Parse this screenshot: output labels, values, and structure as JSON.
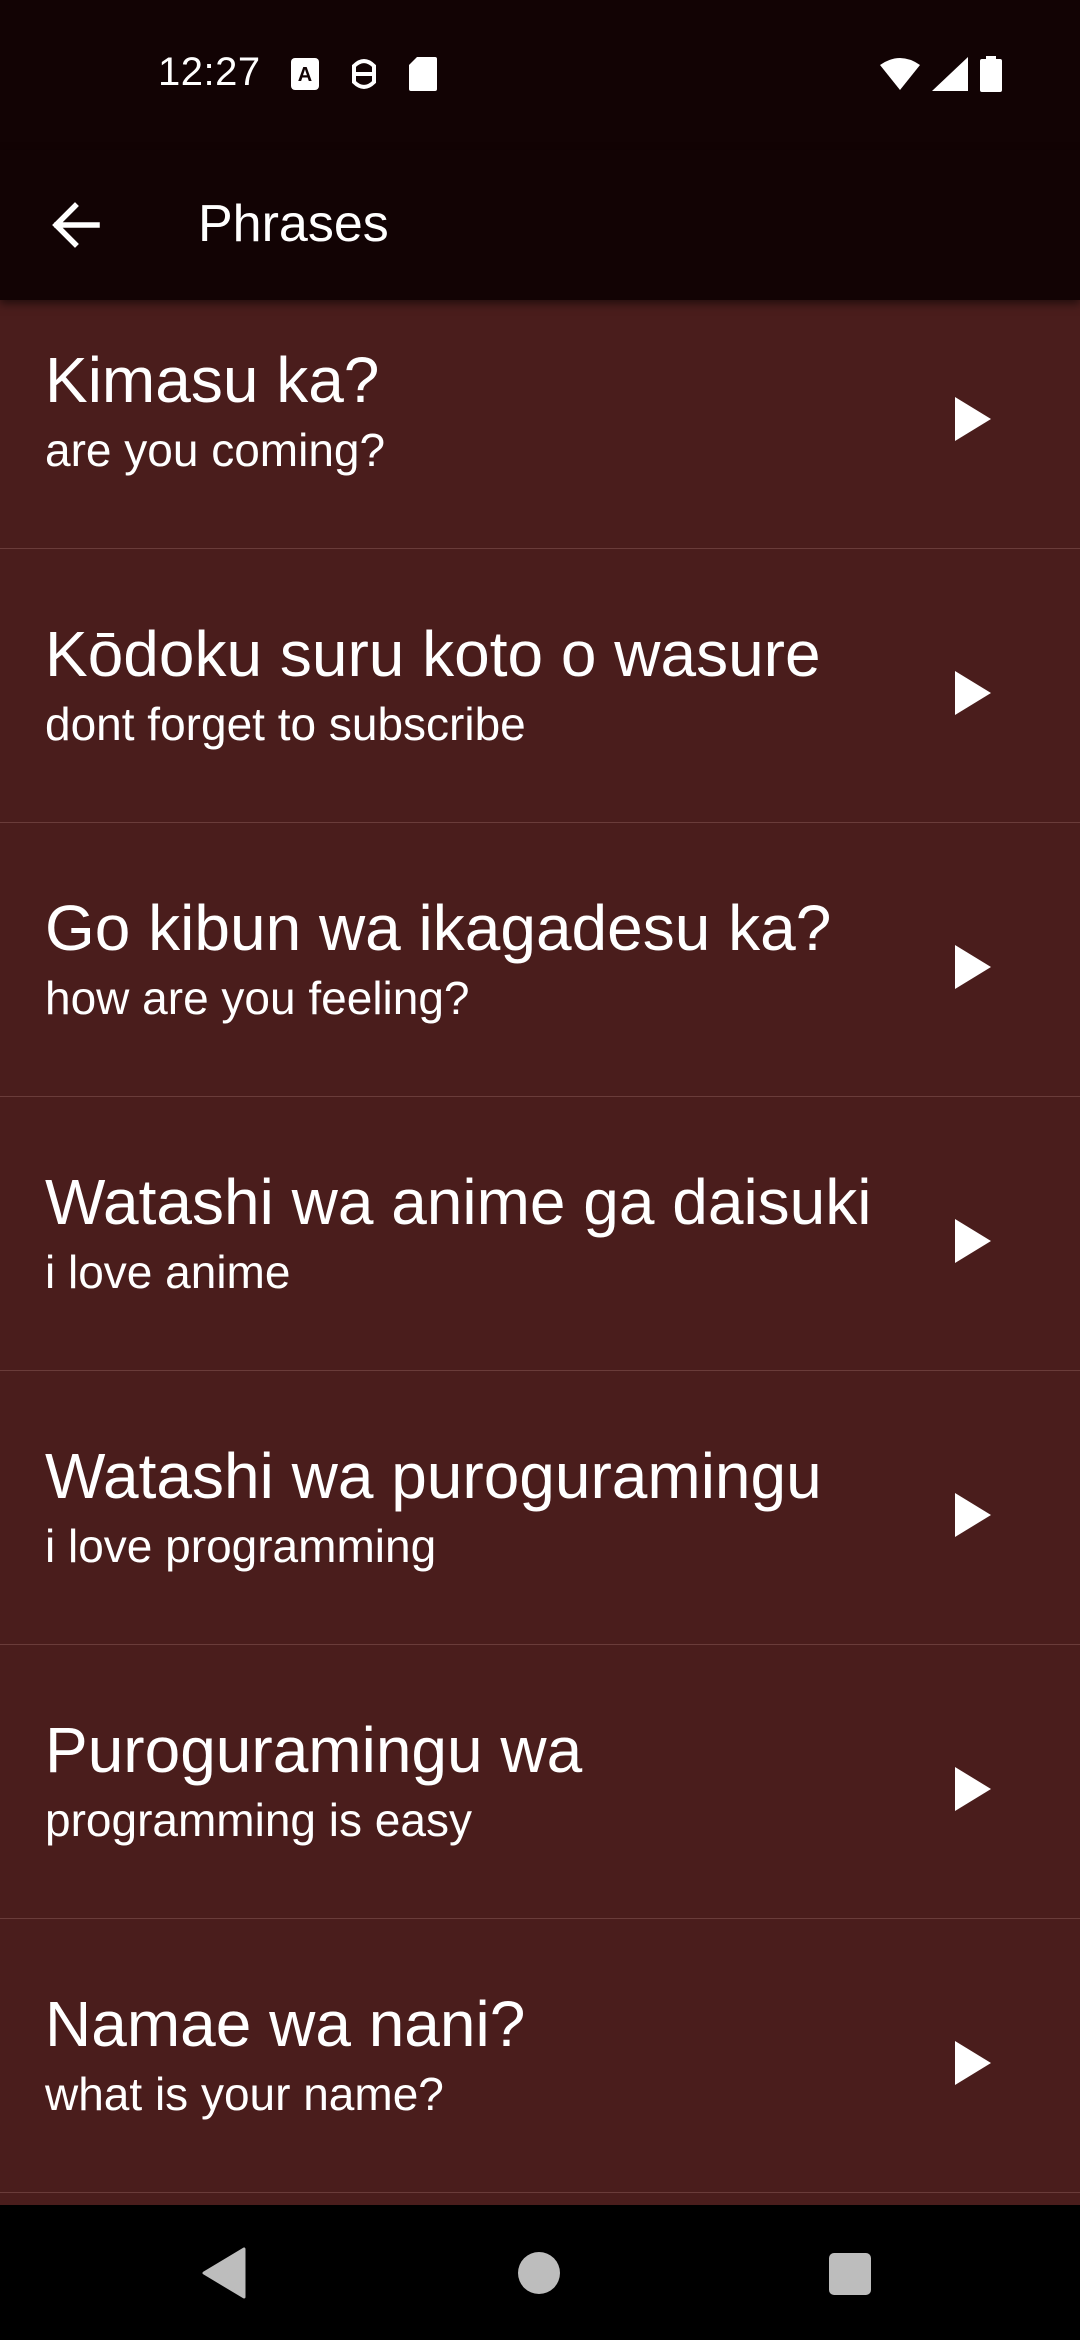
{
  "status_bar": {
    "time": "12:27",
    "left_icons": [
      "font-notification-icon",
      "android-debug-icon",
      "sd-card-icon"
    ],
    "right_icons": [
      "wifi-icon",
      "cell-signal-icon",
      "battery-icon"
    ]
  },
  "app_bar": {
    "title": "Phrases",
    "back_icon": "arrow-back-icon"
  },
  "phrases": [
    {
      "phrase": "Kimasu ka?",
      "translation": "are you coming?"
    },
    {
      "phrase": "Kōdoku suru koto o wasure",
      "translation": "dont forget to subscribe"
    },
    {
      "phrase": "Go kibun wa ikagadesu ka?",
      "translation": "how are you feeling?"
    },
    {
      "phrase": "Watashi wa anime ga daisuki",
      "translation": "i love anime"
    },
    {
      "phrase": "Watashi wa puroguramingu",
      "translation": "i love programming"
    },
    {
      "phrase": "Puroguramingu wa",
      "translation": "programming is easy"
    },
    {
      "phrase": "Namae wa nani?",
      "translation": "what is your name?"
    }
  ],
  "nav_bar": {
    "icons": [
      "nav-back-icon",
      "nav-home-icon",
      "nav-recents-icon"
    ]
  },
  "colors": {
    "background": "#4a1d1c",
    "app_bar": "#120304",
    "divider": "#6a3c3a",
    "text": "#ffffff"
  }
}
